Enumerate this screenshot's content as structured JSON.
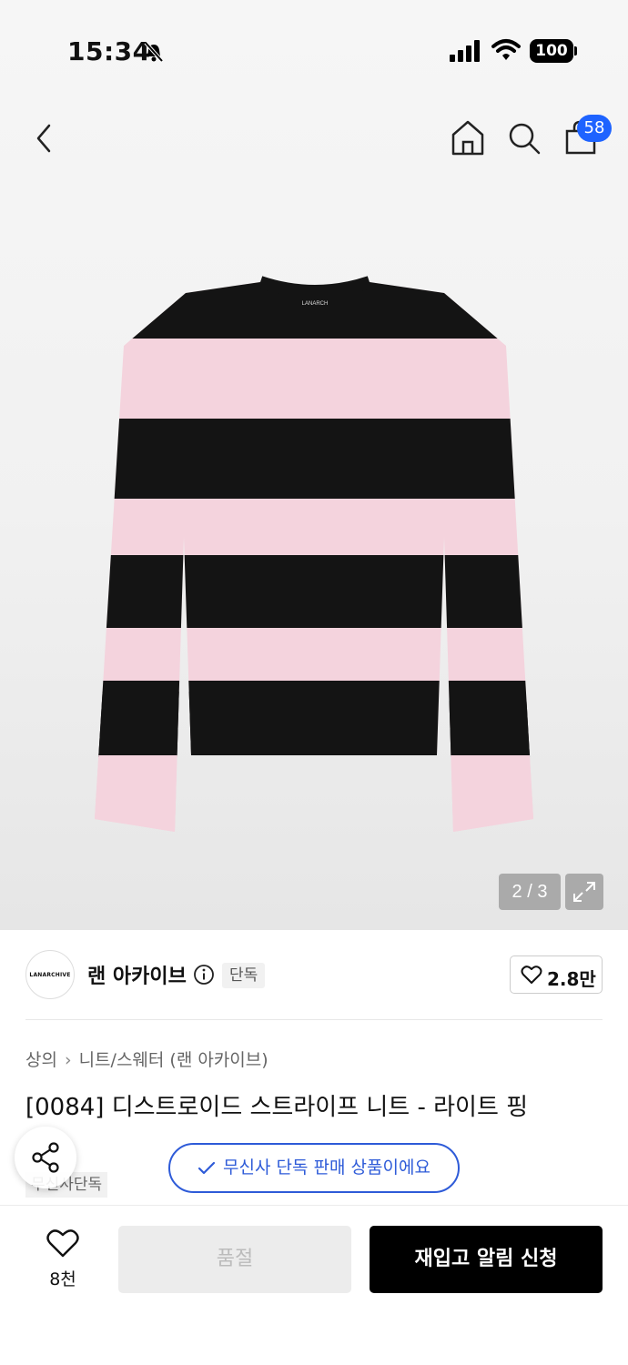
{
  "status_bar": {
    "time": "15:34",
    "battery": "100"
  },
  "header": {
    "cart_count": "58"
  },
  "gallery": {
    "sweater_label": "LANARCH",
    "counter": "2 / 3"
  },
  "brand": {
    "logo_text": "LANARCHIVE",
    "name": "랜 아카이브",
    "exclusive_tag": "단독",
    "likes": "2.8만"
  },
  "breadcrumb": {
    "category": "상의",
    "subcategory": "니트/스웨터 (랜 아카이브)"
  },
  "product": {
    "title": "[0084] 디스트로이드 스트라이프 니트 - 라이트 핑",
    "tag": "무신사단독",
    "exclusive_notice": "무신사 단독 판매 상품이에요"
  },
  "bottom_bar": {
    "wish_count": "8천",
    "soldout_label": "품절",
    "restock_label": "재입고 알림 신청"
  },
  "colors": {
    "accent_blue": "#2e5bd8",
    "badge_blue": "#1e63ff",
    "stripe_pink": "#f4d3dd",
    "stripe_black": "#141414"
  }
}
